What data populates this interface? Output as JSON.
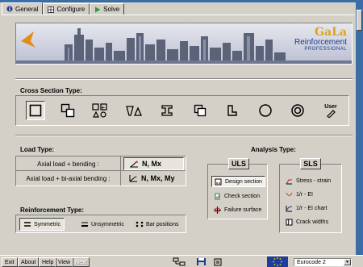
{
  "tabs": [
    {
      "label": "General",
      "icon": "info-icon",
      "active": true
    },
    {
      "label": "Configure",
      "icon": "grid-icon",
      "active": false
    },
    {
      "label": "Solve",
      "icon": "play-icon",
      "active": false
    }
  ],
  "banner": {
    "brand_name": "GaLa",
    "brand_line2": "Reinforcement",
    "brand_line3": "PROFESSIONAL"
  },
  "cross_section": {
    "title": "Cross Section Type:",
    "shapes": [
      "rectangle-section",
      "composite-rect-section",
      "custom-multi-section",
      "t-triangle-section",
      "i-beam-section",
      "box-section",
      "l-section",
      "circle-section",
      "ring-section",
      "user-section"
    ],
    "user_label": "User",
    "selected_index": 0
  },
  "load_type": {
    "title": "Load Type:",
    "rows": [
      {
        "label": "Axial load + bending :",
        "value": "N, Mx",
        "selected": true
      },
      {
        "label": "Axial load + bi-axial bending :",
        "value": "N, Mx, My",
        "selected": false
      }
    ]
  },
  "reinforcement_type": {
    "title": "Reinforcement Type:",
    "options": [
      {
        "label": "Symmetric",
        "selected": true
      },
      {
        "label": "Unsymmetric",
        "selected": false
      },
      {
        "label": "Bar positions",
        "selected": false
      }
    ]
  },
  "analysis_type": {
    "title": "Analysis Type:",
    "uls": {
      "title": "ULS",
      "items": [
        {
          "label": "Design section",
          "selected": true
        },
        {
          "label": "Check section",
          "selected": false
        },
        {
          "label": "Failure surface",
          "selected": false
        }
      ]
    },
    "sls": {
      "title": "SLS",
      "items": [
        {
          "label": "Stress - strain",
          "selected": false
        },
        {
          "label": "1/r - EI",
          "selected": false
        },
        {
          "label": "1/r - EI chart",
          "selected": false
        },
        {
          "label": "Crack widths",
          "selected": false
        }
      ]
    }
  },
  "bottom": {
    "buttons": [
      "Exit",
      "About",
      "Help",
      "View",
      "Next"
    ],
    "disabled": [
      "Next"
    ],
    "code_select": "Eurocode 2"
  },
  "colors": {
    "accent_blue": "#3a6ea5",
    "face": "#d4d0c8",
    "brand_gold": "#e3a21a",
    "brand_blue": "#1d3b8a",
    "eu_blue": "#1e3d9a"
  }
}
